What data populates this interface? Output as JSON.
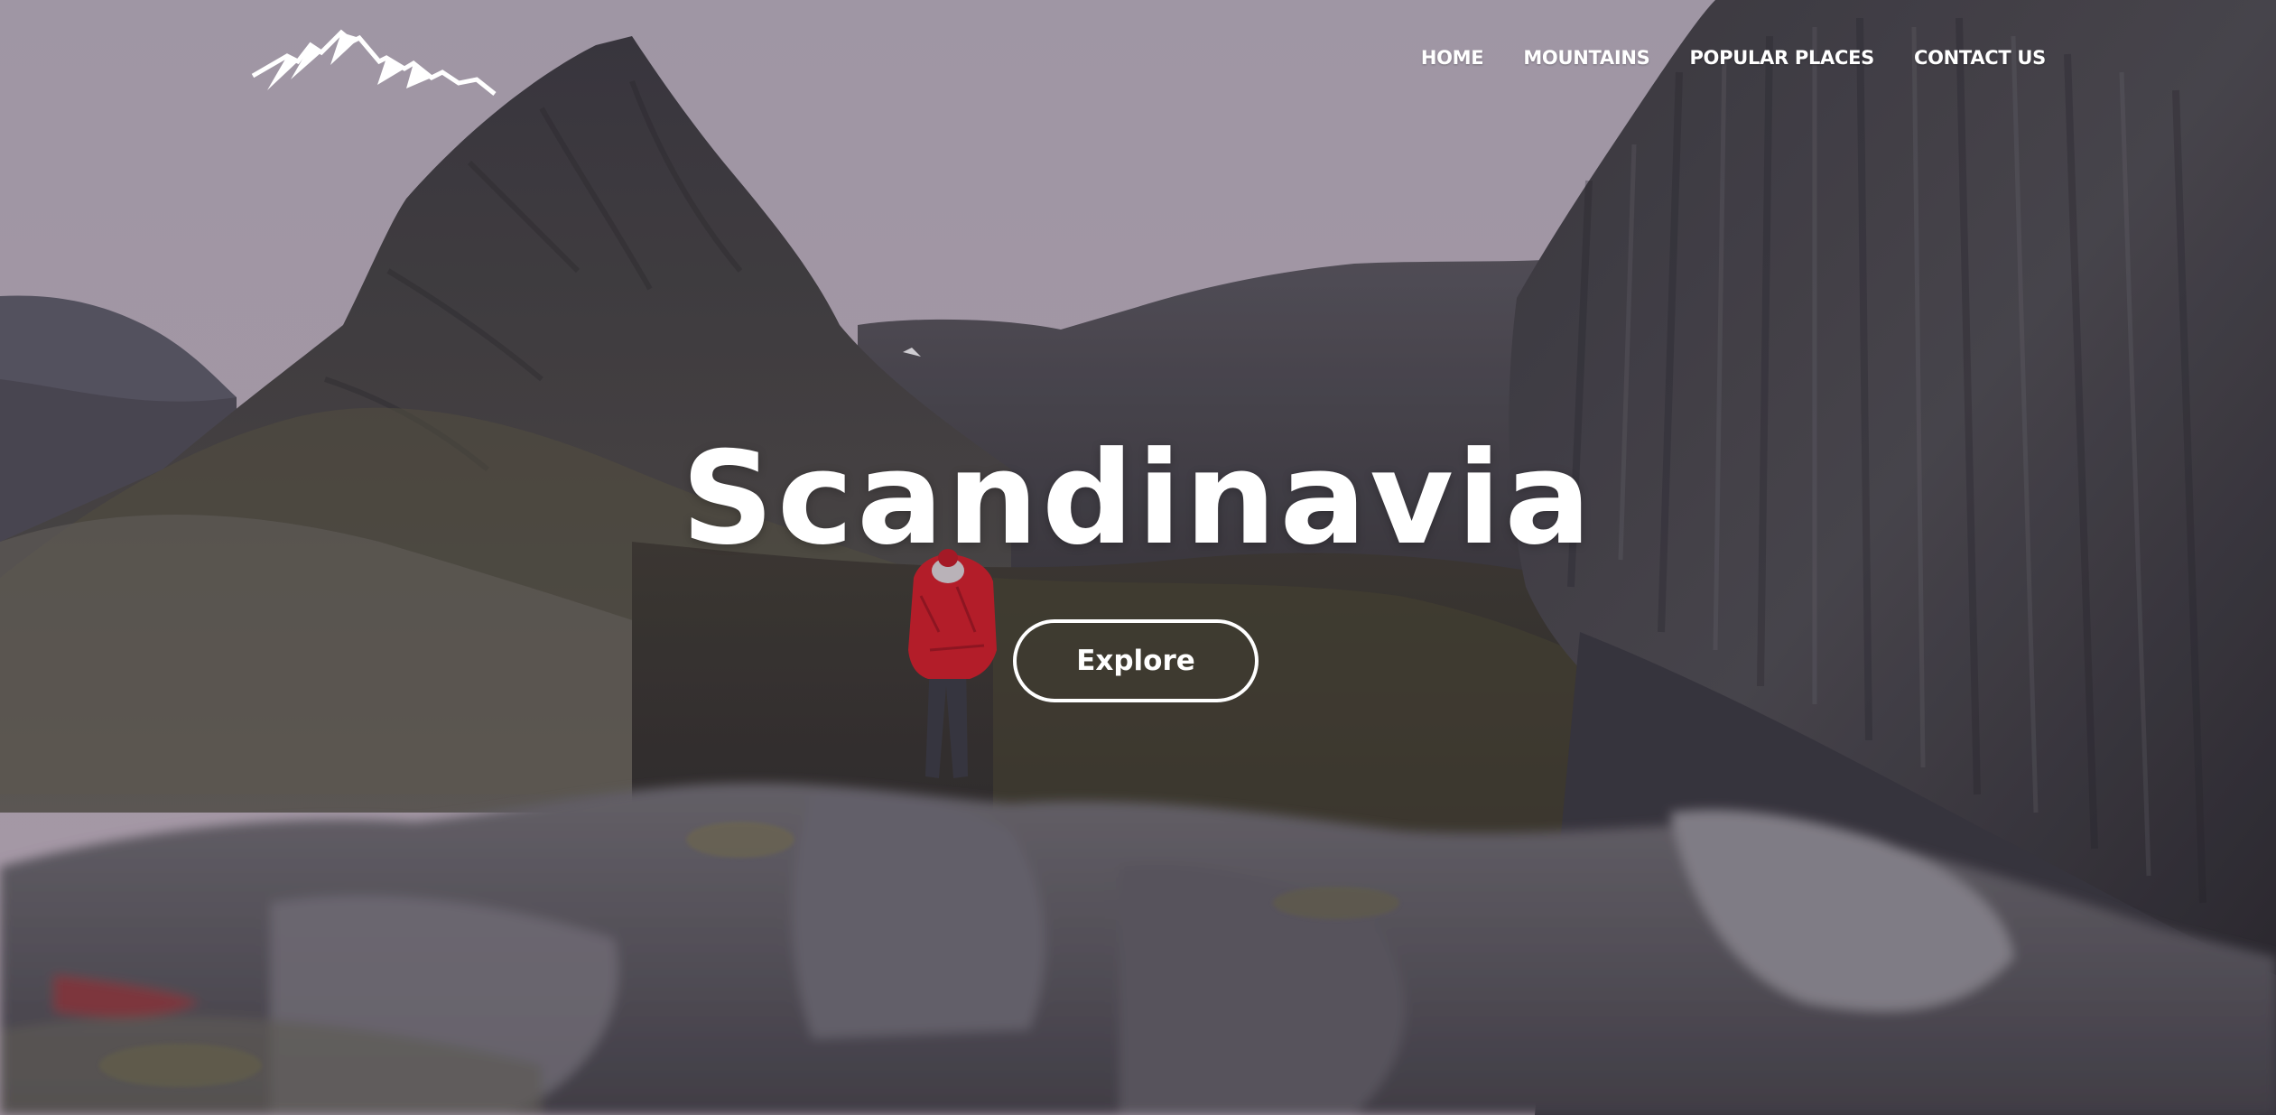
{
  "header": {
    "logo_icon": "mountain-peaks-icon",
    "nav": [
      {
        "label": "HOME"
      },
      {
        "label": "MOUNTAINS"
      },
      {
        "label": "POPULAR PLACES"
      },
      {
        "label": "CONTACT US"
      }
    ]
  },
  "hero": {
    "title": "Scandinavia",
    "cta_label": "Explore"
  },
  "colors": {
    "sky": "#b3aab6",
    "rock_dark": "#35333b",
    "jacket": "#c81e2a",
    "text": "#ffffff"
  }
}
